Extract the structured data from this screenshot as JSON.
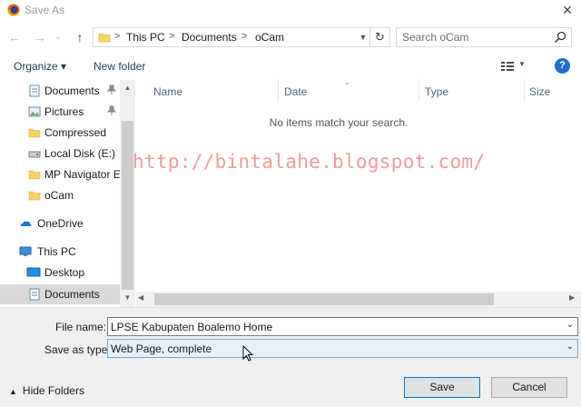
{
  "window": {
    "title": "Save As",
    "close_glyph": "✕"
  },
  "nav": {
    "back_glyph": "←",
    "forward_glyph": "→",
    "recent_glyph": "⌄",
    "up_glyph": "↑",
    "breadcrumb": [
      "This PC",
      "Documents",
      "oCam"
    ],
    "separator": ">",
    "refresh_glyph": "↻",
    "search_placeholder": "Search oCam"
  },
  "commands": {
    "organize": "Organize ▾",
    "new_folder": "New folder",
    "help_glyph": "?"
  },
  "sidebar": {
    "items": [
      {
        "label": "Documents",
        "icon": "documents-icon",
        "pinned": true
      },
      {
        "label": "Pictures",
        "icon": "pictures-icon",
        "pinned": true
      },
      {
        "label": "Compressed",
        "icon": "folder-icon",
        "pinned": false
      },
      {
        "label": "Local Disk (E:)",
        "icon": "drive-icon",
        "pinned": false
      },
      {
        "label": "MP Navigator EX",
        "icon": "folder-icon",
        "pinned": false
      },
      {
        "label": "oCam",
        "icon": "folder-icon",
        "pinned": false
      },
      {
        "label": "OneDrive",
        "icon": "onedrive-icon",
        "pinned": false
      },
      {
        "label": "This PC",
        "icon": "computer-icon",
        "pinned": false
      },
      {
        "label": "Desktop",
        "icon": "desktop-icon",
        "pinned": false
      },
      {
        "label": "Documents",
        "icon": "documents-icon",
        "pinned": false,
        "selected": true
      }
    ]
  },
  "filelist": {
    "columns": [
      "Name",
      "Date",
      "Type",
      "Size"
    ],
    "empty_message": "No items match your search.",
    "watermark": "http://bintalahe.blogspot.com/"
  },
  "form": {
    "filename_label": "File name:",
    "filename_value": "LPSE Kabupaten Boalemo  Home",
    "savetype_label": "Save as type:",
    "savetype_value": "Web Page, complete",
    "hide_folders": "Hide Folders",
    "save": "Save",
    "cancel": "Cancel"
  },
  "colors": {
    "accent": "#0078d7",
    "selected_bg": "#d9d9d9",
    "watermark": "#f39a9a"
  }
}
